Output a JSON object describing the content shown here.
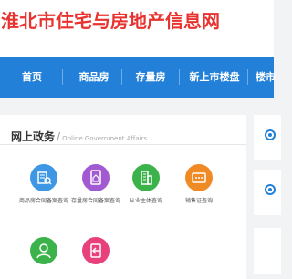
{
  "header": {
    "title": "淮北市住宅与房地产信息网"
  },
  "nav": {
    "items": [
      {
        "label": "首页"
      },
      {
        "label": "商品房"
      },
      {
        "label": "存量房"
      },
      {
        "label": "新上市楼盘"
      },
      {
        "label": "楼市"
      }
    ]
  },
  "gov": {
    "title": "网上政务",
    "subtitle": "Online Government Affairs",
    "services": [
      {
        "label": "商品房合同备案查询",
        "icon": "building-search-icon",
        "color": "#3d97e4"
      },
      {
        "label": "存量房合同备案查询",
        "icon": "document-house-icon",
        "color": "#a15ad1"
      },
      {
        "label": "从业主体查询",
        "icon": "office-building-icon",
        "color": "#3cb34a"
      },
      {
        "label": "销售证查询",
        "icon": "certificate-icon",
        "color": "#f08a24"
      },
      {
        "label": "",
        "icon": "user-icon",
        "color": "#3cb34a"
      },
      {
        "label": "",
        "icon": "login-icon",
        "color": "#e8407a"
      }
    ]
  },
  "colors": {
    "brand": "#e8322f",
    "nav": "#2280d8"
  }
}
